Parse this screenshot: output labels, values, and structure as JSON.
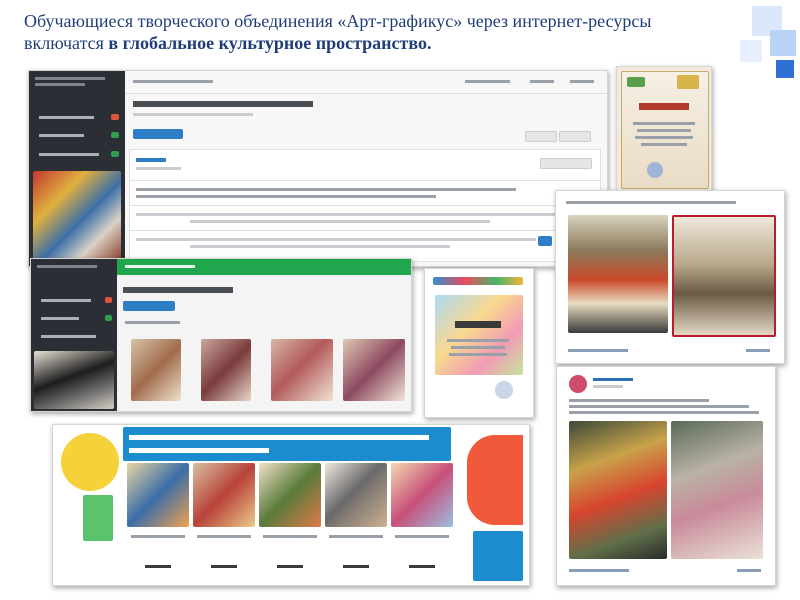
{
  "title": {
    "prefix": "Обучающиеся творческого объединения «Арт-графикус» через интернет-ресурсы включатся ",
    "bold": "в глобальное культурное пространство."
  },
  "screens": [
    {
      "name": "dictation-participants-panel"
    },
    {
      "name": "photo-fixation-panel"
    },
    {
      "name": "diploma-1"
    },
    {
      "name": "diploma-2"
    },
    {
      "name": "social-post-war-portraits"
    },
    {
      "name": "social-post-victory-window"
    },
    {
      "name": "art-action-teachers-banner"
    }
  ],
  "colors": {
    "title": "#1f3d7a",
    "app_green": "#20a64c",
    "sidebar_dark": "#2b2f35",
    "deco_blue": "#2f6fd6",
    "banner_blue": "#1a8ccf",
    "banner_green": "#15a87a"
  }
}
